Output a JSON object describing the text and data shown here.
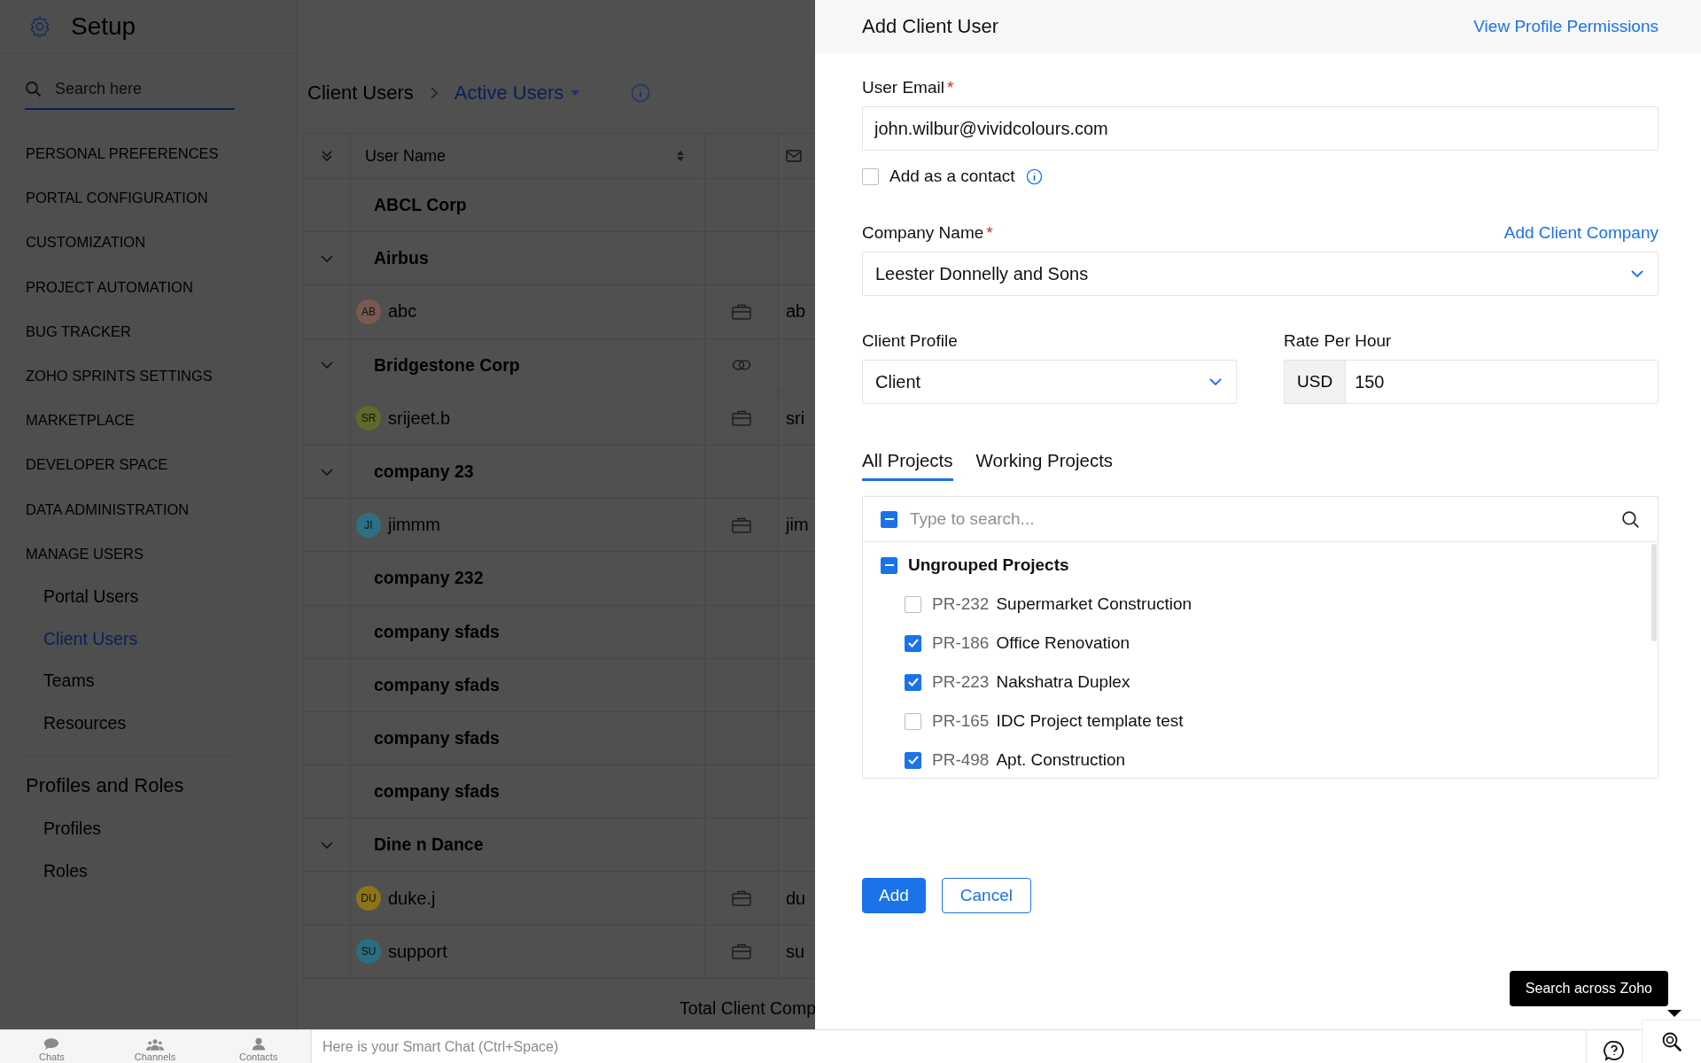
{
  "setup": {
    "title": "Setup",
    "search": {
      "placeholder": "Search here"
    },
    "sections": [
      {
        "label": "PERSONAL PREFERENCES"
      },
      {
        "label": "PORTAL CONFIGURATION"
      },
      {
        "label": "CUSTOMIZATION"
      },
      {
        "label": "PROJECT AUTOMATION"
      },
      {
        "label": "BUG TRACKER"
      },
      {
        "label": "ZOHO SPRINTS SETTINGS"
      },
      {
        "label": "MARKETPLACE"
      },
      {
        "label": "DEVELOPER SPACE"
      },
      {
        "label": "DATA ADMINISTRATION"
      },
      {
        "label": "MANAGE USERS",
        "children": [
          {
            "label": "Portal Users",
            "selected": false
          },
          {
            "label": "Client Users",
            "selected": true
          },
          {
            "label": "Teams",
            "selected": false
          },
          {
            "label": "Resources",
            "selected": false
          }
        ]
      }
    ],
    "group": {
      "title": "Profiles and Roles",
      "children": [
        {
          "label": "Profiles",
          "selected": false
        },
        {
          "label": "Roles",
          "selected": false
        }
      ]
    }
  },
  "breadcrumb": {
    "title": "Client Users",
    "current": "Active Users"
  },
  "table": {
    "columns": [
      "User Name"
    ],
    "rows": [
      {
        "kind": "company",
        "name": "ABCL Corp",
        "toggle": false
      },
      {
        "kind": "company",
        "name": "Airbus",
        "toggle": true
      },
      {
        "kind": "user",
        "name": "abc",
        "initials": "AB",
        "color": "#7a5a50",
        "email": "ab"
      },
      {
        "kind": "company",
        "name": "Bridgestone Corp",
        "toggle": true,
        "linked": true
      },
      {
        "kind": "user",
        "name": "srijeet.b",
        "initials": "SR",
        "color": "#5e6a2a",
        "email": "sri"
      },
      {
        "kind": "company",
        "name": "company 23",
        "toggle": true
      },
      {
        "kind": "user",
        "name": "jimmm",
        "initials": "JI",
        "color": "#2f6f86",
        "email": "jim"
      },
      {
        "kind": "company",
        "name": "company 232",
        "toggle": false
      },
      {
        "kind": "company",
        "name": "company sfads",
        "toggle": false
      },
      {
        "kind": "company",
        "name": "company sfads",
        "toggle": false
      },
      {
        "kind": "company",
        "name": "company sfads",
        "toggle": false
      },
      {
        "kind": "company",
        "name": "company sfads",
        "toggle": false
      },
      {
        "kind": "company",
        "name": "Dine n Dance",
        "toggle": true
      },
      {
        "kind": "user",
        "name": "duke.j",
        "initials": "DU",
        "color": "#8c7418",
        "email": "du"
      },
      {
        "kind": "user",
        "name": "support",
        "initials": "SU",
        "color": "#2a6e80",
        "email": "su"
      }
    ],
    "footer": "Total Client Comp"
  },
  "panel": {
    "title": "Add Client User",
    "header_link": "View Profile Permissions",
    "email": {
      "label": "User Email",
      "required_mark": "*",
      "value": "john.wilbur@vividcolours.com"
    },
    "add_contact": {
      "label": "Add as a contact",
      "checked": false
    },
    "company": {
      "label": "Company Name",
      "required_mark": "*",
      "link": "Add Client Company",
      "value": "Leester Donnelly and Sons"
    },
    "profile": {
      "label": "Client Profile",
      "value": "Client"
    },
    "rate": {
      "label": "Rate Per Hour",
      "currency": "USD",
      "value": "150"
    },
    "tabs": [
      {
        "label": "All Projects",
        "selected": true
      },
      {
        "label": "Working Projects",
        "selected": false
      }
    ],
    "projects": {
      "placeholder": "Type to search...",
      "select_all_indeterminate": true,
      "group": {
        "label": "Ungrouped Projects",
        "indeterminate": true
      },
      "items": [
        {
          "code": "PR-232",
          "name": "Supermarket Construction",
          "checked": false
        },
        {
          "code": "PR-186",
          "name": "Office Renovation",
          "checked": true
        },
        {
          "code": "PR-223",
          "name": "Nakshatra Duplex",
          "checked": true
        },
        {
          "code": "PR-165",
          "name": "IDC Project template test",
          "checked": false
        },
        {
          "code": "PR-498",
          "name": "Apt. Construction",
          "checked": true
        }
      ]
    },
    "buttons": [
      "Add",
      "Cancel"
    ]
  },
  "bottom_bar": {
    "nav": [
      "Chats",
      "Channels",
      "Contacts"
    ],
    "chat_placeholder": "Here is your Smart Chat (Ctrl+Space)",
    "tooltip": "Search across Zoho"
  }
}
